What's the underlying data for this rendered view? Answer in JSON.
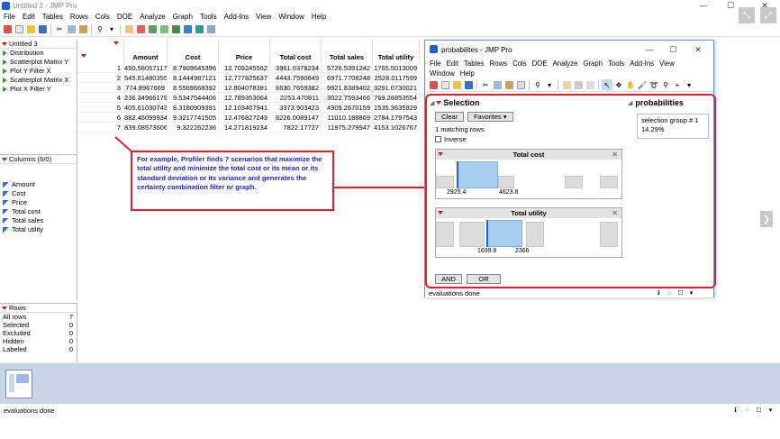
{
  "main": {
    "title": "Untitled 3 - JMP Pro",
    "menu": [
      "File",
      "Edit",
      "Tables",
      "Rows",
      "Cols",
      "DOE",
      "Analyze",
      "Graph",
      "Tools",
      "Add-Ins",
      "View",
      "Window",
      "Help"
    ],
    "status": "evaluations done"
  },
  "table_panel": {
    "title": "Untitled 3",
    "scripts": [
      "Distribution",
      "Scatterplot Matrix Y",
      "Plot Y Filter X",
      "Scatterplot Matrix X",
      "Plot X Filter Y"
    ]
  },
  "columns_panel": {
    "title": "Columns (6/0)",
    "items": [
      "Amount",
      "Cost",
      "Price",
      "Total cost",
      "Total sales",
      "Total utility"
    ]
  },
  "rows_panel": {
    "title": "Rows",
    "items": [
      {
        "label": "All rows",
        "value": "7"
      },
      {
        "label": "Selected",
        "value": "0"
      },
      {
        "label": "Excluded",
        "value": "0"
      },
      {
        "label": "Hidden",
        "value": "0"
      },
      {
        "label": "Labeled",
        "value": "0"
      }
    ]
  },
  "grid": {
    "headers": [
      "Amount",
      "Cost",
      "Price",
      "Total cost",
      "Total sales",
      "Total utility"
    ],
    "rows": [
      [
        "1",
        "450.58057117",
        "8.7909645396",
        "12.709245562",
        "3961.0378234",
        "5726.5391242",
        "1765.5013009"
      ],
      [
        "2",
        "545.61480355",
        "8.1444987121",
        "12.777825637",
        "4443.7590649",
        "6971.7708248",
        "2528.0117599"
      ],
      [
        "3",
        "774.8967669",
        "8.5569668392",
        "12.804078381",
        "6630.7659382",
        "9921.8389402",
        "3291.0730021"
      ],
      [
        "4",
        "236.34966179",
        "9.5347544406",
        "12.789353064",
        "2253.470811",
        "3022.7593466",
        "769.28853554"
      ],
      [
        "5",
        "405.61030743",
        "8.3180909391",
        "12.103407941",
        "3373.903423",
        "4909.2670159",
        "1535.3635929"
      ],
      [
        "6",
        "882.45099934",
        "9.3217741505",
        "12.476827243",
        "8226.0089147",
        "11010.188869",
        "2784.1797543"
      ],
      [
        "7",
        "839.08573606",
        "9.322262236",
        "14.271819234",
        "7822.17727",
        "11975.279947",
        "4153.1026767"
      ]
    ]
  },
  "annotation": "For example, Profiler finds 7 scenarios that maximize the total utility and minimize the total cost or its mean or its standard deviation or its variance and generates the certainty combination filter or graph.",
  "prob_window": {
    "title": "probabilites - JMP Pro",
    "menu1": [
      "File",
      "Edit",
      "Tables",
      "Rows",
      "Cols",
      "DOE",
      "Analyze",
      "Graph",
      "Tools",
      "Add-Ins",
      "View"
    ],
    "menu2": [
      "Window",
      "Help"
    ],
    "selection": {
      "title": "Selection",
      "clear": "Clear",
      "favorites": "Favorites",
      "matching": "1 matching rows",
      "inverse": "Inverse",
      "and": "AND",
      "or": "OR"
    },
    "filters": [
      {
        "name": "Total cost",
        "low": "2925.4",
        "high": "4623.8"
      },
      {
        "name": "Total utility",
        "low": "1699.8",
        "high": "2366"
      }
    ],
    "probabilities": {
      "title": "probabilities",
      "group": "selection group # 1",
      "value": "14.29%"
    },
    "status": "evaluations done"
  },
  "colors": {
    "accent_red": "#e0202a",
    "annotation_text": "#2323c8",
    "selection_fill": "#a9cdef",
    "selection_line": "#1e60c9"
  }
}
